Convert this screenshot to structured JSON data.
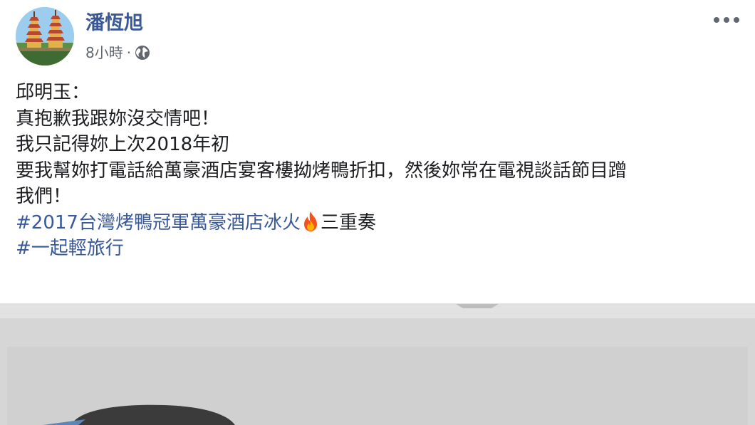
{
  "post": {
    "author": "潘恆旭",
    "timestamp": "8小時",
    "separator": "·",
    "audience_icon": "globe-icon",
    "menu_icon": "more-options-icon",
    "avatar_icon": "pagoda-avatar"
  },
  "content": {
    "line1": "邱明玉：",
    "line2": "真抱歉我跟妳沒交情吧！",
    "line3": "我只記得妳上次2018年初",
    "line4": "要我幫妳打電話給萬豪酒店宴客樓拗烤鴨折扣，然後妳常在電視談話節目蹭",
    "line5": "我們！",
    "hashtag1": "#2017台灣烤鴨冠軍萬豪酒店冰火",
    "hashtag1_suffix": "三重奏",
    "hashtag2": "#一起輕旅行",
    "emoji": "fire-icon"
  },
  "colors": {
    "link": "#385898",
    "text": "#1c1e21",
    "meta": "#616770"
  }
}
